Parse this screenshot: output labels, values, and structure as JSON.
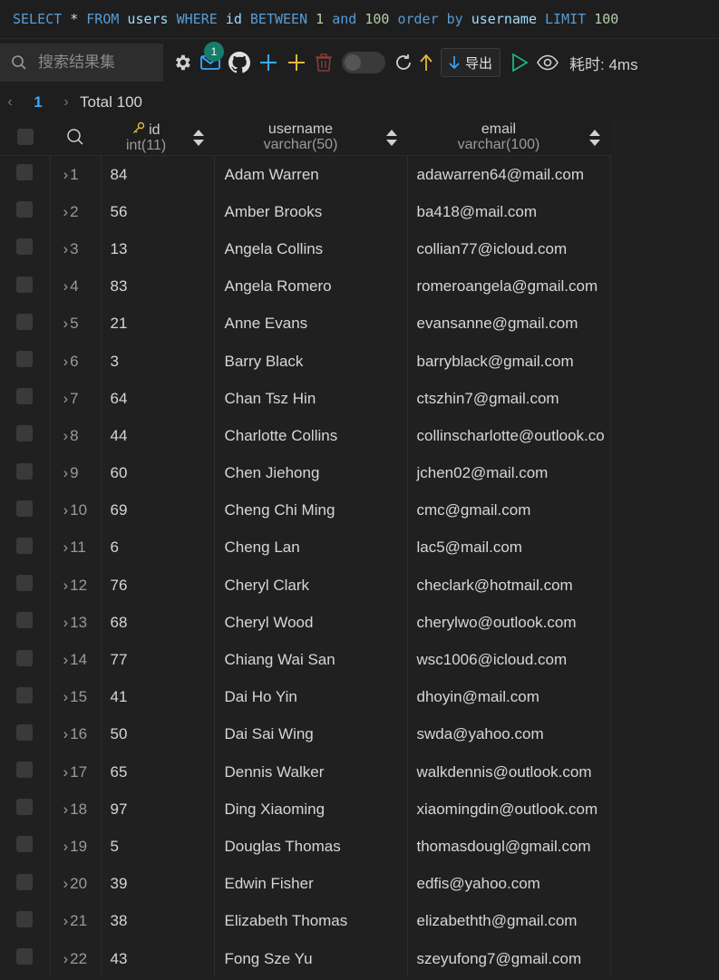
{
  "query": {
    "tokens": [
      {
        "t": "SELECT",
        "c": "kw"
      },
      {
        "t": " * ",
        "c": "op"
      },
      {
        "t": "FROM",
        "c": "kw"
      },
      {
        "t": " users ",
        "c": "id"
      },
      {
        "t": "WHERE",
        "c": "kw"
      },
      {
        "t": " id ",
        "c": "id"
      },
      {
        "t": "BETWEEN",
        "c": "kw"
      },
      {
        "t": " 1 ",
        "c": "num"
      },
      {
        "t": "and",
        "c": "kw"
      },
      {
        "t": " 100 ",
        "c": "num"
      },
      {
        "t": "order by",
        "c": "kw"
      },
      {
        "t": " username ",
        "c": "id"
      },
      {
        "t": "LIMIT",
        "c": "kw"
      },
      {
        "t": " 100",
        "c": "num"
      }
    ]
  },
  "toolbar": {
    "search_placeholder": "搜索结果集",
    "mail_badge": "1",
    "export_label": "导出",
    "time_label": "耗时: 4ms",
    "icons": [
      "gear-icon",
      "mail-icon",
      "github-icon",
      "add-icon",
      "plus-icon",
      "trash-icon",
      "toggle",
      "refresh-icon",
      "upload-icon",
      "export-icon",
      "run-icon",
      "preview-icon"
    ]
  },
  "pager": {
    "page": "1",
    "total": "Total 100"
  },
  "columns": [
    {
      "name": "id",
      "type": "int(11)",
      "key": true
    },
    {
      "name": "username",
      "type": "varchar(50)"
    },
    {
      "name": "email",
      "type": "varchar(100)"
    }
  ],
  "rows": [
    {
      "n": "1",
      "id": "84",
      "username": "Adam Warren",
      "email": "adawarren64@mail.com"
    },
    {
      "n": "2",
      "id": "56",
      "username": "Amber Brooks",
      "email": "ba418@mail.com"
    },
    {
      "n": "3",
      "id": "13",
      "username": "Angela Collins",
      "email": "collian77@icloud.com"
    },
    {
      "n": "4",
      "id": "83",
      "username": "Angela Romero",
      "email": "romeroangela@gmail.com"
    },
    {
      "n": "5",
      "id": "21",
      "username": "Anne Evans",
      "email": "evansanne@gmail.com"
    },
    {
      "n": "6",
      "id": "3",
      "username": "Barry Black",
      "email": "barryblack@gmail.com"
    },
    {
      "n": "7",
      "id": "64",
      "username": "Chan Tsz Hin",
      "email": "ctszhin7@gmail.com"
    },
    {
      "n": "8",
      "id": "44",
      "username": "Charlotte Collins",
      "email": "collinscharlotte@outlook.co"
    },
    {
      "n": "9",
      "id": "60",
      "username": "Chen Jiehong",
      "email": "jchen02@mail.com"
    },
    {
      "n": "10",
      "id": "69",
      "username": "Cheng Chi Ming",
      "email": "cmc@gmail.com"
    },
    {
      "n": "11",
      "id": "6",
      "username": "Cheng Lan",
      "email": "lac5@mail.com"
    },
    {
      "n": "12",
      "id": "76",
      "username": "Cheryl Clark",
      "email": "checlark@hotmail.com"
    },
    {
      "n": "13",
      "id": "68",
      "username": "Cheryl Wood",
      "email": "cherylwo@outlook.com"
    },
    {
      "n": "14",
      "id": "77",
      "username": "Chiang Wai San",
      "email": "wsc1006@icloud.com"
    },
    {
      "n": "15",
      "id": "41",
      "username": "Dai Ho Yin",
      "email": "dhoyin@mail.com"
    },
    {
      "n": "16",
      "id": "50",
      "username": "Dai Sai Wing",
      "email": "swda@yahoo.com"
    },
    {
      "n": "17",
      "id": "65",
      "username": "Dennis Walker",
      "email": "walkdennis@outlook.com"
    },
    {
      "n": "18",
      "id": "97",
      "username": "Ding Xiaoming",
      "email": "xiaomingdin@outlook.com"
    },
    {
      "n": "19",
      "id": "5",
      "username": "Douglas Thomas",
      "email": "thomasdougl@gmail.com"
    },
    {
      "n": "20",
      "id": "39",
      "username": "Edwin Fisher",
      "email": "edfis@yahoo.com"
    },
    {
      "n": "21",
      "id": "38",
      "username": "Elizabeth Thomas",
      "email": "elizabethth@gmail.com"
    },
    {
      "n": "22",
      "id": "43",
      "username": "Fong Sze Yu",
      "email": "szeyufong7@gmail.com"
    }
  ]
}
